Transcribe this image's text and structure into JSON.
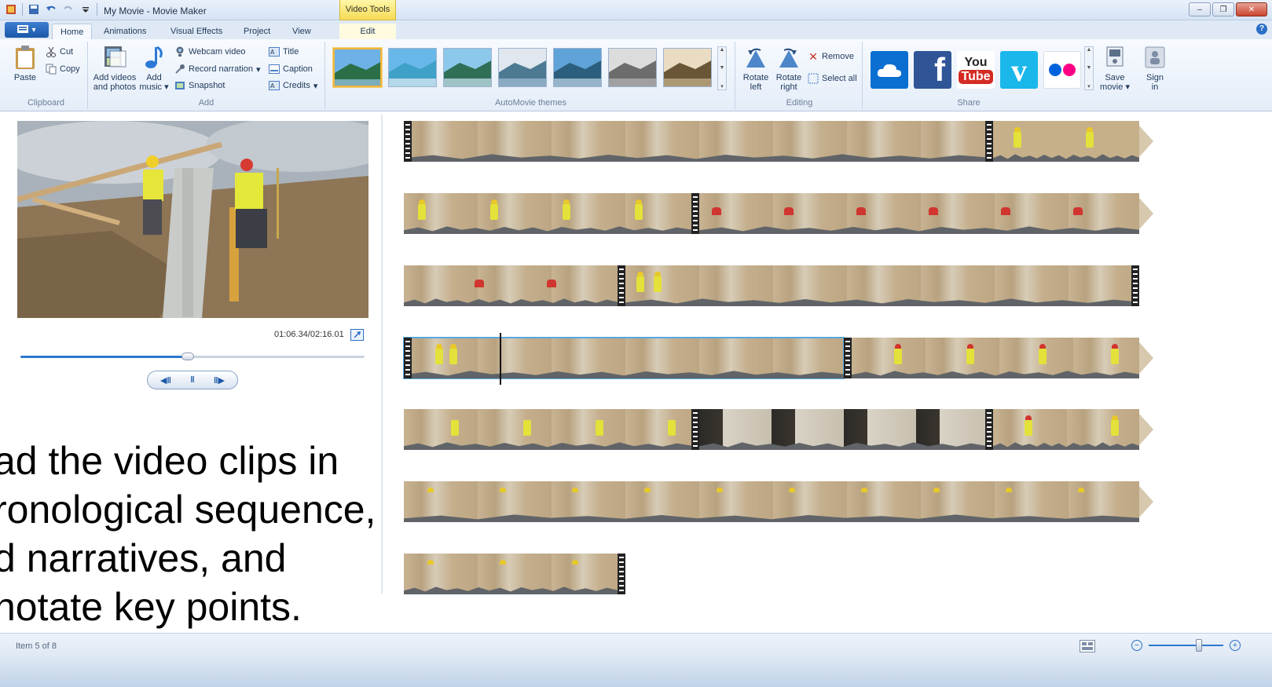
{
  "window": {
    "title": "My Movie - Movie Maker",
    "context_tab_header": "Video Tools",
    "minimize": "–",
    "restore": "❐",
    "close": "✕"
  },
  "tabs": [
    {
      "label": "Home",
      "active": true
    },
    {
      "label": "Animations",
      "active": false
    },
    {
      "label": "Visual Effects",
      "active": false
    },
    {
      "label": "Project",
      "active": false
    },
    {
      "label": "View",
      "active": false
    },
    {
      "label": "Edit",
      "active": false
    }
  ],
  "ribbon": {
    "clipboard": {
      "label": "Clipboard",
      "paste": "Paste",
      "cut": "Cut",
      "copy": "Copy"
    },
    "add": {
      "label": "Add",
      "add_videos": [
        "Add videos",
        "and photos"
      ],
      "add_music": [
        "Add",
        "music"
      ],
      "webcam": "Webcam video",
      "record_narration": "Record narration",
      "snapshot": "Snapshot",
      "title": "Title",
      "caption": "Caption",
      "credits": "Credits"
    },
    "themes": {
      "label": "AutoMovie themes",
      "count": 7,
      "selected_index": 0
    },
    "editing": {
      "label": "Editing",
      "rotate_left": [
        "Rotate",
        "left"
      ],
      "rotate_right": [
        "Rotate",
        "right"
      ],
      "remove": "Remove",
      "select_all": "Select all"
    },
    "share": {
      "label": "Share",
      "services": [
        {
          "name": "cloud-icon",
          "color": "#0a6fd1"
        },
        {
          "name": "facebook-icon",
          "color": "#2f5597"
        },
        {
          "name": "youtube-icon",
          "color": "#ffffff"
        },
        {
          "name": "vimeo-icon",
          "color": "#1ab7ea"
        },
        {
          "name": "flickr-icon",
          "color": "#ffffff"
        }
      ],
      "youtube_top": "You",
      "youtube_bottom": "Tube",
      "facebook_letter": "f",
      "vimeo_letter": "v",
      "save_movie": [
        "Save",
        "movie"
      ],
      "sign_in": [
        "Sign",
        "in"
      ]
    }
  },
  "preview": {
    "timecode": "01:06.34/02:16.01",
    "progress": 0.486,
    "buttons": {
      "prev": "◀‖",
      "pause": "‖",
      "next": "‖▶"
    }
  },
  "overlay_lines": [
    "ad the video clips in",
    "ronological sequence,",
    "d narratives, and",
    "notate key points."
  ],
  "status": {
    "item_text": "Item 5 of 8",
    "zoom_minus": "−",
    "zoom_plus": "+",
    "zoom_level": 0.67
  },
  "colors": {
    "accent": "#2b78d0",
    "selection": "#58a8e0",
    "context_tab": "#f5db56"
  }
}
